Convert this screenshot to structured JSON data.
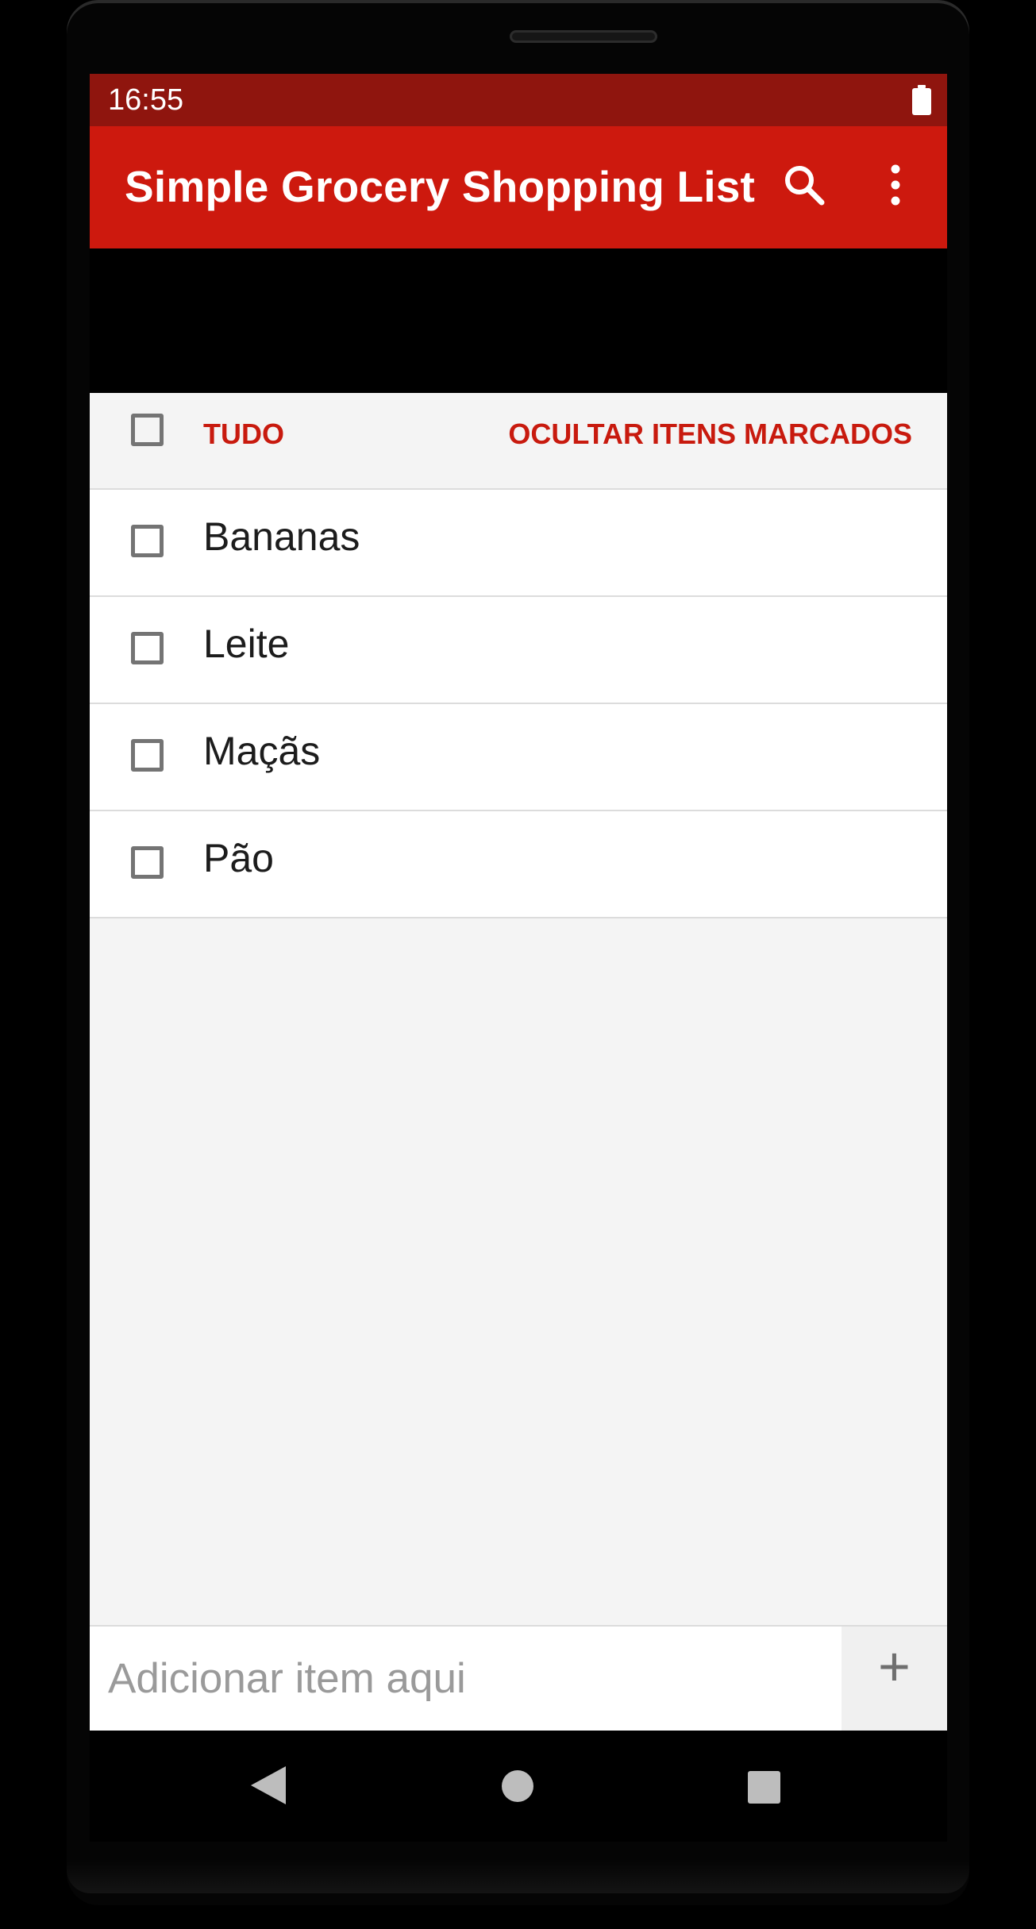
{
  "status_bar": {
    "time": "16:55",
    "battery_icon": "battery-full-icon"
  },
  "toolbar": {
    "title": "Simple Grocery Shopping List",
    "search_icon": "search-icon",
    "more_icon": "more-vert-icon"
  },
  "list_header": {
    "select_all_label": "TUDO",
    "hide_checked_label": "OCULTAR ITENS MARCADOS"
  },
  "items": [
    {
      "label": "Bananas",
      "checked": false
    },
    {
      "label": "Leite",
      "checked": false
    },
    {
      "label": "Maçãs",
      "checked": false
    },
    {
      "label": "Pão",
      "checked": false
    }
  ],
  "add_bar": {
    "placeholder": "Adicionar item aqui",
    "add_icon": "+"
  },
  "colors": {
    "status_bar": "#8f150e",
    "toolbar": "#cd190e",
    "accent": "#c81a0e",
    "background": "#f4f4f4"
  }
}
